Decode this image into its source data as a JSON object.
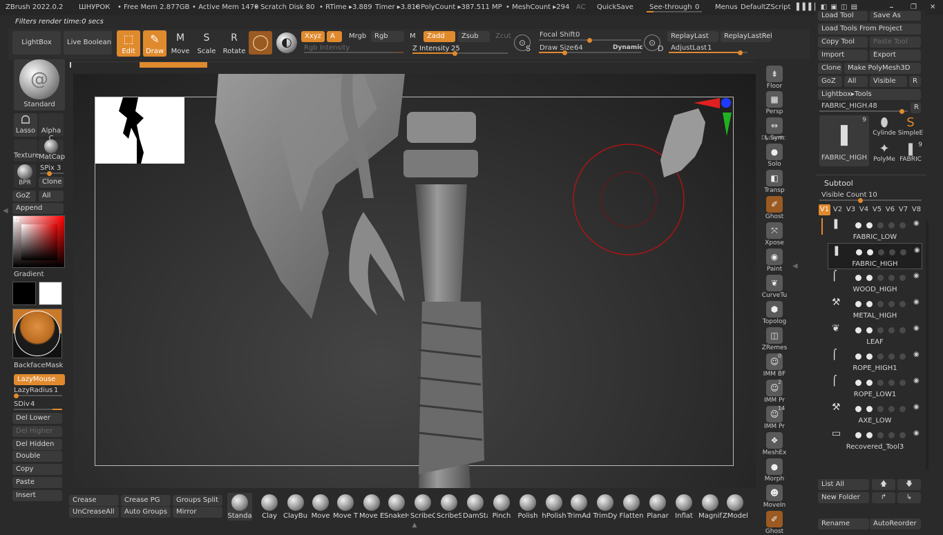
{
  "app": {
    "title": "ZBrush 2022.0.2",
    "project": "ШНУРОК",
    "stats": {
      "free_mem": "• Free Mem 2.877GB",
      "active_mem": "• Active Mem 1470",
      "scratch": "• Scratch Disk 80",
      "rtime": "• RTime ▸3.889",
      "timer": "Timer ▸3.818",
      "polycount": "• PolyCount ▸387.511 MP",
      "meshcount": "• MeshCount ▸294",
      "ac": "AC"
    },
    "quicksave": "QuickSave",
    "seethrough_label": "See-through",
    "seethrough_value": "0",
    "menus": "Menus",
    "script": "DefaultZScript",
    "filters_msg": "Filters render time:0 secs"
  },
  "toolbar": {
    "lightbox": "LightBox",
    "live_boolean": "Live Boolean",
    "edit": "Edit",
    "draw": "Draw",
    "move": "Move",
    "scale": "Scale",
    "rotate": "Rotate",
    "xyz": "Xxyz",
    "a": "A",
    "mrgb": "Mrgb",
    "rgb": "Rgb",
    "m": "M",
    "zadd": "Zadd",
    "zsub": "Zsub",
    "zcut": "Zcut",
    "rgb_intensity": "Rgb Intensity",
    "z_intensity_label": "Z Intensity",
    "z_intensity": "25",
    "focal_shift_label": "Focal Shift",
    "focal_shift": "0",
    "draw_size_label": "Draw Size",
    "draw_size": "64",
    "dynamic": "Dynamic",
    "replay_last": "ReplayLast",
    "replay_last_rel": "ReplayLastRel",
    "adjust_last_label": "AdjustLast",
    "adjust_last": "1",
    "s_key": "S",
    "d_key": "D"
  },
  "left": {
    "brush": "Standard",
    "lasso": "Lasso",
    "alpha": "Alpha C",
    "texture": "Texture",
    "matcap": "MatCap",
    "bpr": "BPR",
    "spix_label": "SPix",
    "spix": "3",
    "clone": "Clone",
    "goz": "GoZ",
    "all": "All",
    "append": "Append",
    "gradient": "Gradient",
    "backface": "BackfaceMask",
    "lazymouse": "LazyMouse",
    "lazyradius_label": "LazyRadius",
    "lazyradius": "1",
    "sdiv_label": "SDiv",
    "sdiv": "4",
    "del_lower": "Del Lower",
    "del_higher": "Del Higher",
    "del_hidden": "Del Hidden",
    "double": "Double",
    "copy": "Copy",
    "paste": "Paste",
    "insert": "Insert"
  },
  "shelf": [
    {
      "name": "Floor",
      "icon": "floor-icon"
    },
    {
      "name": "Persp",
      "icon": "persp-icon"
    },
    {
      "name": "L.Sym",
      "icon": "lsym-icon"
    },
    {
      "name": "Solo",
      "icon": "solo-icon"
    },
    {
      "name": "Transp",
      "icon": "transp-icon"
    },
    {
      "name": "Ghost",
      "icon": "ghost-icon"
    },
    {
      "name": "Xpose",
      "icon": "xpose-icon"
    },
    {
      "name": "Paint",
      "icon": "paint-icon"
    },
    {
      "name": "CurveTu",
      "icon": "curvetube-icon"
    },
    {
      "name": "Topolog",
      "icon": "topology-icon"
    },
    {
      "name": "ZRemes",
      "icon": "zremesher-icon"
    },
    {
      "name": "IMM BF",
      "icon": "imm-icon"
    },
    {
      "name": "IMM Pr",
      "icon": "imm-icon"
    },
    {
      "name": "IMM Pr",
      "icon": "imm-icon"
    },
    {
      "name": "MeshEx",
      "icon": "meshextract-icon"
    },
    {
      "name": "Morph",
      "icon": "morph-icon"
    },
    {
      "name": "MoveIn",
      "icon": "movein-icon"
    },
    {
      "name": "Ghost",
      "icon": "ghost-icon"
    }
  ],
  "shelf_extra": {
    "dynamic_label": "Dynamic",
    "imm_count_1": "0",
    "imm_count_2": "2",
    "imm_count_3": "14"
  },
  "tool_panel": {
    "load_tool": "Load Tool",
    "save_as": "Save As",
    "load_from_project": "Load Tools From Project",
    "copy_tool": "Copy Tool",
    "paste_tool": "Paste Tool",
    "import": "Import",
    "export": "Export",
    "clone": "Clone",
    "make_polymesh": "Make PolyMesh3D",
    "goz": "GoZ",
    "all": "All",
    "visible": "Visible",
    "r": "R",
    "lightbox_tools": "Lightbox▸Tools",
    "current_tool": "FABRIC_HIGH.",
    "current_val": "48",
    "thumbs": [
      {
        "name": "FABRIC_HIGH",
        "count": "9"
      },
      {
        "name": "Cylinde"
      },
      {
        "name": "SimpleE"
      },
      {
        "name": "PolyMe"
      },
      {
        "name": "FABRIC",
        "count": "9"
      }
    ]
  },
  "subtool": {
    "title": "Subtool",
    "visible_count_label": "Visible Count",
    "visible_count": "10",
    "versions": [
      "V1",
      "V2",
      "V3",
      "V4",
      "V5",
      "V6",
      "V7",
      "V8"
    ],
    "items": [
      "FABRIC_LOW",
      "FABRIC_HIGH",
      "WOOD_HIGH",
      "METAL_HIGH",
      "LEAF",
      "ROPE_HIGH1",
      "ROPE_LOW1",
      "AXE_LOW",
      "Recovered_Tool3"
    ],
    "list_all": "List All",
    "new_folder": "New Folder",
    "rename": "Rename",
    "autoreorder": "AutoReorder"
  },
  "bottom": {
    "crease": "Crease",
    "crease_pg": "Crease PG",
    "groups_split": "Groups Split",
    "uncrease_all": "UnCreaseAll",
    "auto_groups": "Auto Groups",
    "mirror": "Mirror",
    "brushes": [
      "Standa",
      "Clay",
      "ClayBui",
      "Move",
      "Move T",
      "Move E",
      "SnakeH",
      "ScribeC",
      "ScribeS",
      "DamSta",
      "Pinch",
      "Polish",
      "hPolish",
      "TrimAd",
      "TrimDy",
      "Flatten",
      "Planar",
      "Inflat",
      "Magnif",
      "ZModel"
    ]
  }
}
